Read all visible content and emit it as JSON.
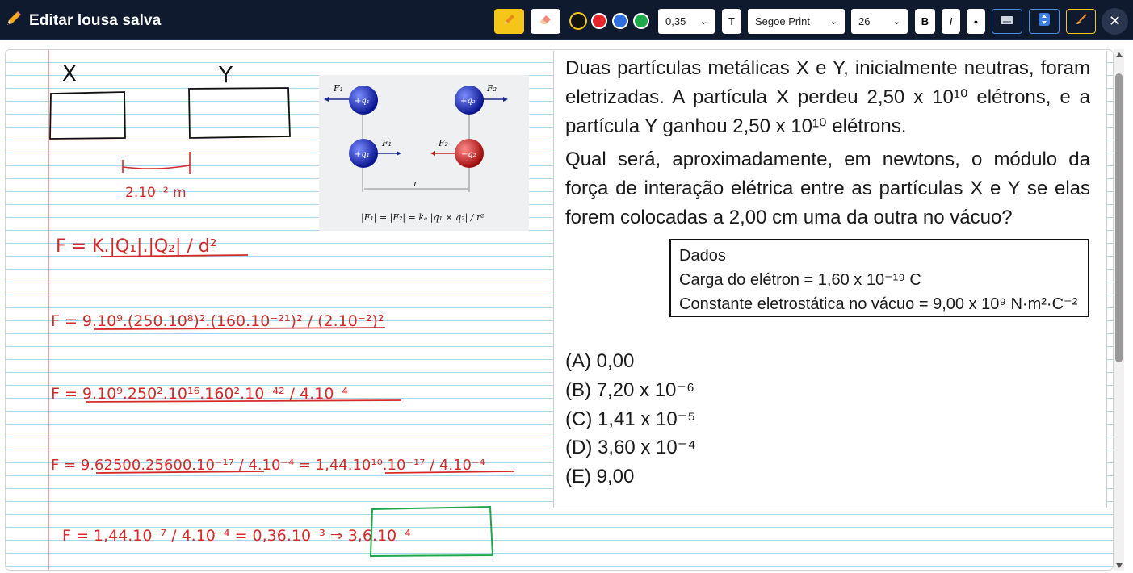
{
  "window": {
    "title": "Editar lousa salva"
  },
  "toolbar": {
    "thickness": "0,35",
    "text_tool": "T",
    "font": "Segoe Print",
    "font_size": "26",
    "bold": "B",
    "italic": "I",
    "dot": "•",
    "close": "✕",
    "colors": {
      "black": "#111111",
      "red": "#e5262a",
      "blue": "#2f6fe0",
      "green": "#1fa84a",
      "accent": "#f5c518"
    }
  },
  "figure": {
    "f1": "F₁",
    "f2": "F₂",
    "q1": "+q₁",
    "q2": "+q₂",
    "neg_q2": "−q₂",
    "r": "r",
    "formula": "|F₁| = |F₂| = kₑ |q₁ × q₂| / r²"
  },
  "question": {
    "paragraph1": "Duas partículas metálicas X e Y, inicialmente neutras, foram eletrizadas. A partícula X perdeu 2,50 x 10¹⁰ elétrons, e a partícula Y ganhou 2,50 x 10¹⁰ elétrons.",
    "paragraph2": "Qual será, aproximadamente, em newtons, o módulo da força de interação elétrica entre as partículas X e Y se elas forem colocadas a 2,00 cm uma da outra no vácuo?",
    "data_title": "Dados",
    "data_line1": "Carga do elétron = 1,60 x 10⁻¹⁹ C",
    "data_line2": "Constante eletrostática no vácuo = 9,00 x 10⁹ N·m²·C⁻²",
    "options": [
      "(A) 0,00",
      "(B) 7,20 x 10⁻⁶",
      "(C) 1,41 x 10⁻⁵",
      "(D) 3,60 x 10⁻⁴",
      "(E) 9,00"
    ]
  },
  "handwriting": {
    "x_label": "X",
    "y_label": "Y",
    "distance": "2.10⁻² m",
    "line1": "F = K.|Q₁|.|Q₂| / d²",
    "line2": "F = 9.10⁹.(250.10⁸)².(160.10⁻²¹)² / (2.10⁻²)²",
    "line3": "F = 9.10⁹.250².10¹⁶.160².10⁻⁴² / 4.10⁻⁴",
    "line4": "F = 9.62500.25600.10⁻¹⁷ / 4.10⁻⁴ = 1,44.10¹⁰.10⁻¹⁷ / 4.10⁻⁴",
    "line5": "F = 1,44.10⁻⁷ / 4.10⁻⁴ = 0,36.10⁻³ ⇒ 3,6.10⁻⁴"
  }
}
